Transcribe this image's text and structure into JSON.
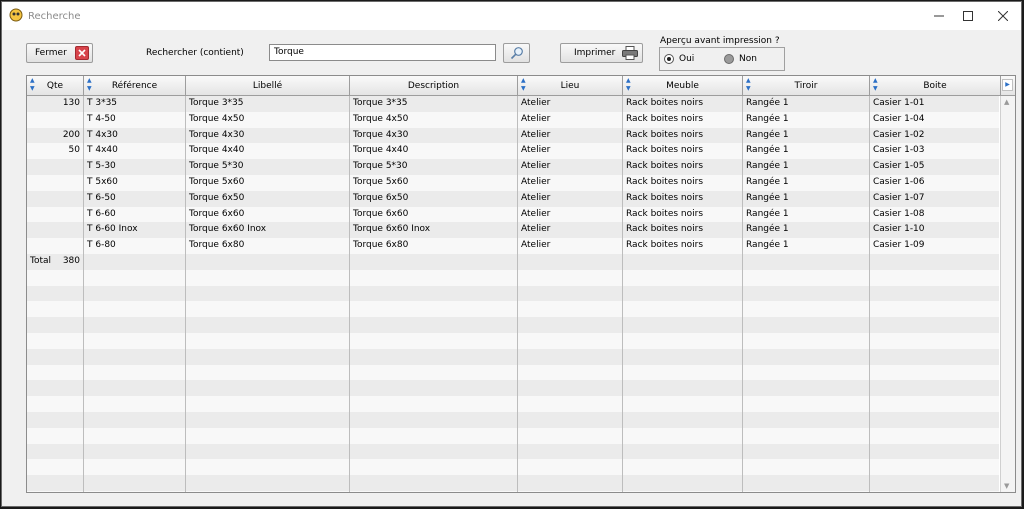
{
  "window": {
    "title": "Recherche"
  },
  "toolbar": {
    "fermer_label": "Fermer",
    "search_label": "Rechercher (contient)",
    "search_value": "Torque",
    "imprimer_label": "Imprimer",
    "apercu_label": "Aperçu avant impression ?",
    "radio_oui": "Oui",
    "radio_non": "Non",
    "apercu_selected": "Oui"
  },
  "grid": {
    "columns": [
      "Qte",
      "Référence",
      "Libellé",
      "Description",
      "Lieu",
      "Meuble",
      "Tiroir",
      "Boite"
    ],
    "rows": [
      [
        "130",
        "T 3*35",
        "Torque 3*35",
        "Torque 3*35",
        "Atelier",
        "Rack boites noirs",
        "Rangée 1",
        "Casier 1-01"
      ],
      [
        "",
        "T 4-50",
        "Torque 4x50",
        "Torque 4x50",
        "Atelier",
        "Rack boites noirs",
        "Rangée 1",
        "Casier 1-04"
      ],
      [
        "200",
        "T 4x30",
        "Torque 4x30",
        "Torque 4x30",
        "Atelier",
        "Rack boites noirs",
        "Rangée 1",
        "Casier 1-02"
      ],
      [
        "50",
        "T 4x40",
        "Torque 4x40",
        "Torque 4x40",
        "Atelier",
        "Rack boites noirs",
        "Rangée 1",
        "Casier 1-03"
      ],
      [
        "",
        "T 5-30",
        "Torque 5*30",
        "Torque 5*30",
        "Atelier",
        "Rack boites noirs",
        "Rangée 1",
        "Casier 1-05"
      ],
      [
        "",
        "T 5x60",
        "Torque 5x60",
        "Torque 5x60",
        "Atelier",
        "Rack boites noirs",
        "Rangée 1",
        "Casier 1-06"
      ],
      [
        "",
        "T 6-50",
        "Torque 6x50",
        "Torque 6x50",
        "Atelier",
        "Rack boites noirs",
        "Rangée 1",
        "Casier 1-07"
      ],
      [
        "",
        "T 6-60",
        "Torque 6x60",
        "Torque 6x60",
        "Atelier",
        "Rack boites noirs",
        "Rangée 1",
        "Casier 1-08"
      ],
      [
        "",
        "T 6-60 Inox",
        "Torque 6x60 Inox",
        "Torque 6x60 Inox",
        "Atelier",
        "Rack boites noirs",
        "Rangée 1",
        "Casier 1-10"
      ],
      [
        "",
        "T 6-80",
        "Torque 6x80",
        "Torque 6x80",
        "Atelier",
        "Rack boites noirs",
        "Rangée 1",
        "Casier 1-09"
      ]
    ],
    "total_label": "Total",
    "total_value": "380",
    "empty_rows": 15
  },
  "colors": {
    "close_red": "#d8444b",
    "sort_blue": "#2b6fc6"
  },
  "icons": [
    "app-icon",
    "close-x-icon",
    "search-magnifier-icon",
    "printer-icon"
  ]
}
